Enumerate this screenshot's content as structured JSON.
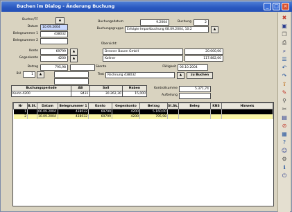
{
  "window": {
    "title": "Buchen im Dialog - Änderung Buchung"
  },
  "form": {
    "buchungsnr_label": "Buchnr/TF",
    "datum_label": "Datum",
    "datum_value": "10.09.2004",
    "belegnummer1_label": "Belegnummer 1",
    "belegnummer1_value": "438032",
    "belegnummer2_label": "Belegnummer 2",
    "konto_label": "Konto",
    "konto_value": "69799",
    "gegenkonto_label": "Gegenkonto",
    "gegenkonto_value": "4200",
    "betrag_label": "Betrag",
    "betrag_value": "795,98",
    "bu_label": "BU",
    "bu_value": "1",
    "buchungsdatum_label": "Buchungsdatum",
    "buchungsdatum_value": "9.2004",
    "buchung_label": "Buchung",
    "buchung_value": "2",
    "buchungsinfo_label": "Buchungsgruppe",
    "buchungsinfo_value": "Erfolgte Importbuchung 08.09.2004, 10:2",
    "uebersicht_label": "Übersicht:",
    "kunde_name": "Dresner Bauen GmbH",
    "kunde_amount": "20.000,00",
    "kunde2_name": "Kollner",
    "kunde2_amount": "117.882,00",
    "faelligkeit_label": "Fälligkeit",
    "faelligkeit_value": "06.10.2004",
    "skonto_label": "Skonto",
    "text_label": "Text",
    "text_value": "Rechnung 438032",
    "zu_buchen_label": "zu Buchen",
    "kontrollsumme_label": "Kontrollsumme",
    "kontrollsumme_value": "5.371,74",
    "aufteilung_label": "Aufteilung"
  },
  "summary": {
    "headers": [
      "Buchungsperiode",
      "AB",
      "Soll",
      "Haben"
    ],
    "row": [
      "Konto 4200",
      "",
      "8431",
      "30.262,30",
      "15,000"
    ]
  },
  "grid": {
    "headers": [
      "Nr",
      "B.St.",
      "Datum",
      "Belegnummer 1",
      "Konto",
      "Gegenkonto",
      "Betrag",
      "St.Sk.",
      "Beleg",
      "KNS",
      "Hinweis"
    ],
    "rows": [
      [
        "1",
        "",
        "06.09.2004",
        "438032",
        "69799",
        "4200",
        "5.160,00",
        "",
        "",
        "",
        ""
      ],
      [
        "2",
        "",
        "10.09.2004",
        "438032",
        "69799",
        "4200",
        "795,98",
        "",
        "",
        "",
        ""
      ]
    ]
  },
  "toolbar": {
    "icons": [
      "close-icon",
      "save-icon",
      "copy-icon",
      "print-icon",
      "search-icon",
      "list-icon",
      "undo-icon",
      "redo-icon",
      "export-icon",
      "edit-icon",
      "filter-icon",
      "cut-icon",
      "paste-icon",
      "delete-icon",
      "calc-icon",
      "help-icon",
      "user-icon",
      "settings-icon",
      "info-icon",
      "exit-icon"
    ]
  }
}
